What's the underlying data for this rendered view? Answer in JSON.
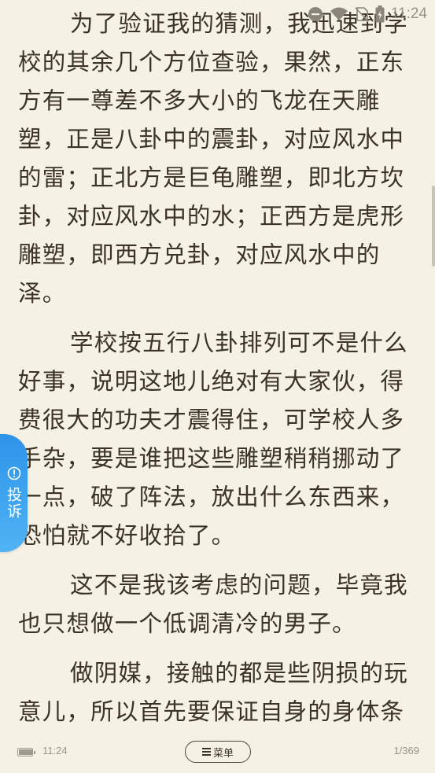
{
  "status_bar": {
    "time": "11:24",
    "icons": [
      "do-not-disturb-icon",
      "wifi-icon",
      "no-sim-icon",
      "battery-charging-icon"
    ]
  },
  "content": {
    "paragraphs": [
      "为了验证我的猜测，我迅速到学校的其余几个方位查验，果然，正东方有一尊差不多大小的飞龙在天雕塑，正是八卦中的震卦，对应风水中的雷；正北方是巨龟雕塑，即北方坎卦，对应风水中的水；正西方是虎形雕塑，即西方兑卦，对应风水中的泽。",
      "学校按五行八卦排列可不是什么好事，说明这地儿绝对有大家伙，得费很大的功夫才震得住，可学校人多手杂，要是谁把这些雕塑稍稍挪动了一点，破了阵法，放出什么东西来，恐怕就不好收拾了。",
      "这不是我该考虑的问题，毕竟我也只想做一个低调清冷的男子。",
      "做阴媒，接触的都是些阴损的玩意儿，所以首先要保证自身的身体条件，所以每天晚上我都会到学"
    ]
  },
  "report_tab": {
    "icon": "alert-circle-icon",
    "label": "投诉"
  },
  "footer": {
    "battery_level": 0.95,
    "time": "11:24",
    "menu_icon": "list-icon",
    "menu_label": "菜单",
    "page_indicator": "1/369"
  },
  "colors": {
    "background": "#f6f1e5",
    "text": "#3b3326",
    "report_tab": "#3aa2ee"
  }
}
